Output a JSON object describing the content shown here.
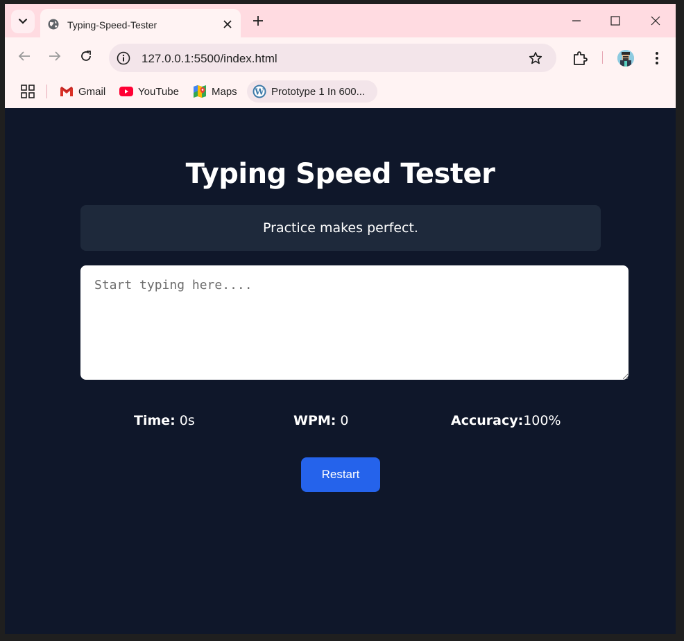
{
  "browser": {
    "tab": {
      "title": "Typing-Speed-Tester",
      "favicon": "globe-icon"
    },
    "address_bar": {
      "url": "127.0.0.1:5500/index.html"
    },
    "bookmarks": [
      {
        "label": "Gmail",
        "icon": "gmail-icon"
      },
      {
        "label": "YouTube",
        "icon": "youtube-icon"
      },
      {
        "label": "Maps",
        "icon": "maps-icon"
      },
      {
        "label": "Prototype 1 In 600...",
        "icon": "wordpress-icon"
      }
    ],
    "colors": {
      "tabstrip": "#ffdbe1",
      "toolbar": "#fff3f3",
      "omnibox": "#f3e5ea"
    }
  },
  "page": {
    "title": "Typing Speed Tester",
    "quote": "Practice makes perfect.",
    "input": {
      "placeholder": "Start typing here....",
      "value": ""
    },
    "stats": {
      "time_label": "Time:",
      "time_value": " 0s",
      "wpm_label": "WPM:",
      "wpm_value": " 0",
      "accuracy_label": "Accuracy:",
      "accuracy_value": "100%"
    },
    "restart_label": "Restart",
    "colors": {
      "background": "#0f172a",
      "quote_box": "#1e293b",
      "button": "#2563eb"
    }
  }
}
